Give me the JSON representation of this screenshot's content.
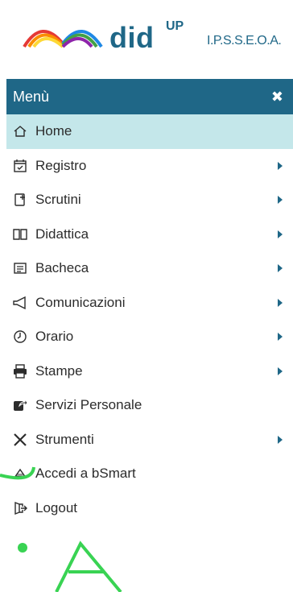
{
  "header": {
    "brand": "did",
    "brand_sup": "UP",
    "school": "I.P.S.S.E.O.A."
  },
  "menu": {
    "title": "Menù",
    "close_icon": "close-icon",
    "items": [
      {
        "label": "Home",
        "icon": "home-icon",
        "active": true,
        "has_submenu": false
      },
      {
        "label": "Registro",
        "icon": "calendar-check-icon",
        "active": false,
        "has_submenu": true
      },
      {
        "label": "Scrutini",
        "icon": "scrutini-icon",
        "active": false,
        "has_submenu": true
      },
      {
        "label": "Didattica",
        "icon": "book-open-icon",
        "active": false,
        "has_submenu": true
      },
      {
        "label": "Bacheca",
        "icon": "bulletin-board-icon",
        "active": false,
        "has_submenu": true
      },
      {
        "label": "Comunicazioni",
        "icon": "megaphone-icon",
        "active": false,
        "has_submenu": true
      },
      {
        "label": "Orario",
        "icon": "clock-icon",
        "active": false,
        "has_submenu": true
      },
      {
        "label": "Stampe",
        "icon": "printer-icon",
        "active": false,
        "has_submenu": true
      },
      {
        "label": "Servizi Personale",
        "icon": "share-icon",
        "active": false,
        "has_submenu": false
      },
      {
        "label": "Strumenti",
        "icon": "tools-icon",
        "active": false,
        "has_submenu": true
      },
      {
        "label": "Accedi a bSmart",
        "icon": "bsmart-icon",
        "active": false,
        "has_submenu": false
      },
      {
        "label": "Logout",
        "icon": "logout-icon",
        "active": false,
        "has_submenu": false
      }
    ]
  },
  "colors": {
    "primary": "#1f6787",
    "active_bg": "#c4e7ea",
    "text": "#2c2c2c",
    "watermark": "#39d353"
  }
}
